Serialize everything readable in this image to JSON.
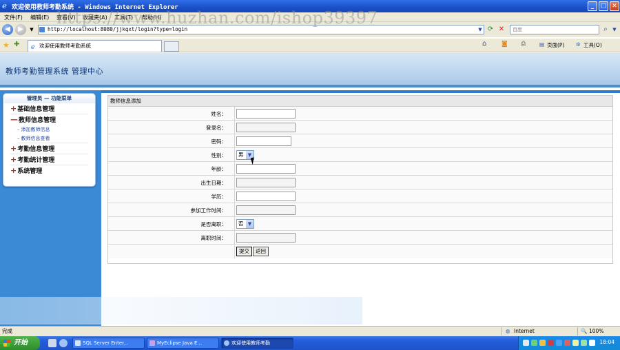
{
  "window": {
    "title": "欢迎使用教师考勤系统 - Windows Internet Explorer",
    "minimize": "_",
    "maximize": "□",
    "close": "✕"
  },
  "menu": [
    "文件(F)",
    "编辑(E)",
    "查看(V)",
    "收藏夹(A)",
    "工具(T)",
    "帮助(H)"
  ],
  "address": {
    "url": "http://localhost:8080/jjkqxt/login?type=login",
    "search_placeholder": "百度"
  },
  "tab": {
    "label": "欢迎使用教师考勤系统"
  },
  "command_bar": {
    "page_label": "页面(P)",
    "tools_label": "工具(O)"
  },
  "watermark": "https://www.huzhan.com/ishop39397",
  "header": {
    "title": "教师考勤管理系统 管理中心"
  },
  "sidebar": {
    "heading": "管理员 — 功能菜单",
    "groups": [
      {
        "sign": "+",
        "label": "基础信息管理"
      },
      {
        "sign": "—",
        "label": "教师信息管理"
      },
      {
        "sign": "+",
        "label": "考勤信息管理"
      },
      {
        "sign": "+",
        "label": "考勤统计管理"
      },
      {
        "sign": "+",
        "label": "系统管理"
      }
    ],
    "subitems": [
      {
        "label": "添加教师信息"
      },
      {
        "label": "教师信息查看"
      }
    ]
  },
  "form": {
    "heading": "教师信息添加",
    "fields": [
      {
        "label": "姓名："
      },
      {
        "label": "登录名："
      },
      {
        "label": "密码："
      },
      {
        "label": "性别：",
        "value": "男"
      },
      {
        "label": "年龄："
      },
      {
        "label": "出生日期："
      },
      {
        "label": "学历："
      },
      {
        "label": "参加工作时间："
      },
      {
        "label": "是否离职：",
        "value": "否"
      },
      {
        "label": "离职时间："
      }
    ],
    "submit_label": "提交",
    "back_label": "返回"
  },
  "status": {
    "text": "完成",
    "zone": "Internet",
    "zoom": "100%"
  },
  "taskbar": {
    "start_label": "开始",
    "tasks": [
      {
        "label": "SQL Server Enter..."
      },
      {
        "label": "MyEclipse Java E..."
      },
      {
        "label": "欢迎使用教师考勤"
      }
    ],
    "clock": "18:04"
  },
  "colors": {
    "titlebar": "#1a50c8",
    "sidebar": "#3a8ad6",
    "header_border": "#4a8ed0",
    "plus_sign": "#d42020"
  }
}
